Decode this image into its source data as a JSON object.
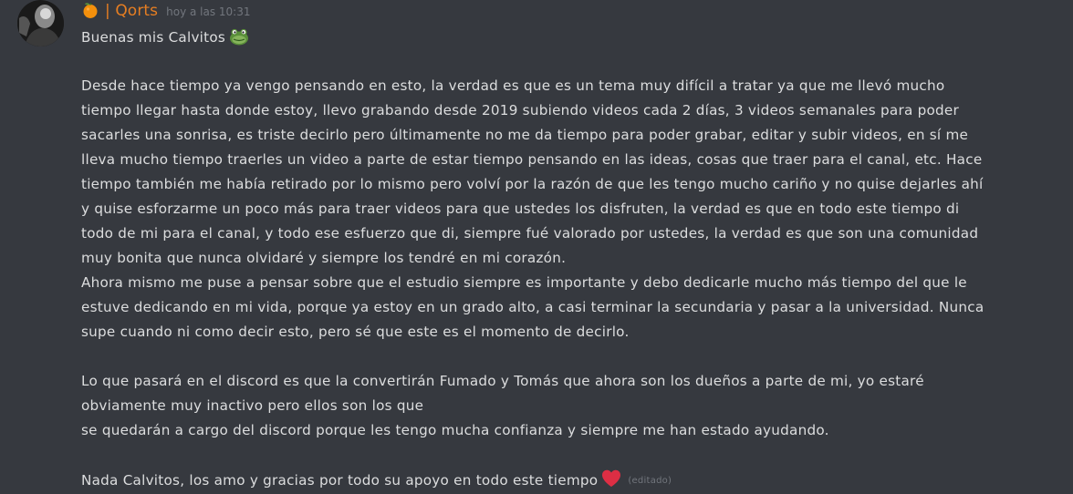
{
  "message": {
    "author": "| Qorts",
    "author_color": "#e67e22",
    "author_emoji": "orange-fruit",
    "timestamp": "hoy a las 10:31",
    "greeting": "Buenas mis Calvitos",
    "greeting_emoji": "frog",
    "lines": [
      "Desde hace tiempo ya vengo pensando en esto, la verdad es que es un tema muy difícil a tratar ya que me llevó mucho",
      "tiempo llegar hasta donde estoy, llevo grabando desde 2019 subiendo videos cada 2 días, 3 videos semanales para poder",
      "sacarles una sonrisa, es triste decirlo pero últimamente no me da tiempo para poder grabar, editar y subir videos, en sí me",
      "lleva mucho tiempo traerles un video a parte de estar tiempo pensando en las ideas, cosas que traer para el canal, etc. Hace",
      "tiempo también me había retirado por lo mismo pero volví por la razón de que les tengo mucho cariño y no quise dejarles ahí",
      "y quise esforzarme un poco más para traer videos para que ustedes los disfruten, la verdad es que en todo este tiempo di",
      "todo de mi para el canal, y todo ese esfuerzo que di, siempre fué valorado por ustedes, la verdad es que son una comunidad",
      "muy bonita que nunca olvidaré y siempre los tendré en mi corazón.",
      "Ahora mismo me puse a pensar sobre que el estudio siempre es importante y debo dedicarle mucho más tiempo del que le",
      "estuve dedicando en mi vida, porque ya estoy en un grado alto, a casi terminar la secundaria y pasar a la universidad. Nunca",
      "supe cuando ni como decir esto, pero sé que este es el momento de decirlo.",
      "",
      "Lo que pasará en el discord es que la convertirán Fumado y Tomás que ahora son los dueños a parte de mi, yo estaré",
      "obviamente muy inactivo pero ellos son los que",
      "se quedarán a cargo del discord porque les tengo mucha confianza y siempre me han estado ayudando.",
      ""
    ],
    "closing": "Nada Calvitos, los amo y gracias por todo su apoyo en todo este tiempo",
    "closing_emoji": "heart",
    "edited_label": "(editado)"
  }
}
